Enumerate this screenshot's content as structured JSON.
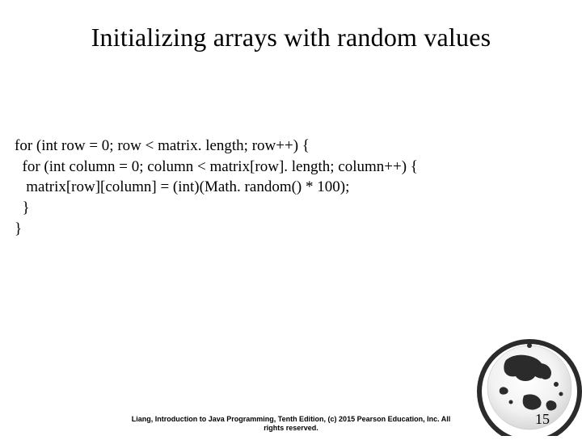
{
  "title": "Initializing arrays with random values",
  "code": {
    "line1": "for (int row = 0; row < matrix. length; row++) {",
    "line2": "  for (int column = 0; column < matrix[row]. length; column++) {",
    "line3": "   matrix[row][column] = (int)(Math. random() * 100);",
    "line4": "  }",
    "line5": "}"
  },
  "footer": {
    "line1": "Liang, Introduction to Java Programming, Tenth Edition, (c) 2015 Pearson Education, Inc. All",
    "line2": "rights reserved."
  },
  "page_number": "15"
}
